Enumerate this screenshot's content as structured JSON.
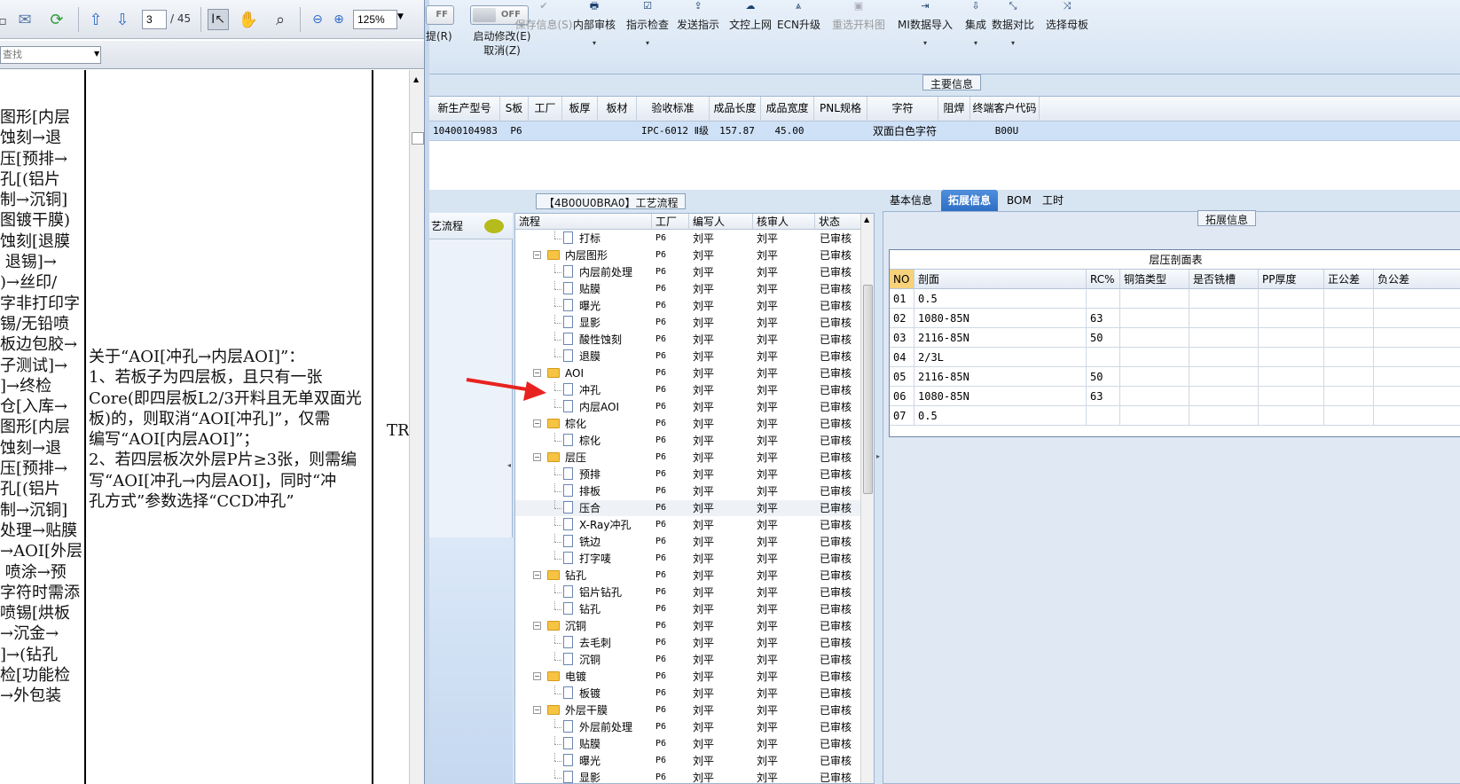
{
  "pdf": {
    "page_current": "3",
    "page_total": "/ 45",
    "zoom": "125%",
    "find_placeholder": "查找",
    "left_column_lines": [
      "图形[内层",
      "蚀刻→退",
      "压[预排→",
      "孔[(铝片",
      "制→沉铜]",
      "图镀干膜)",
      "蚀刻[退膜",
      " 退锡]→",
      ")→丝印/",
      "字非打印字",
      "锡/无铅喷",
      "板边包胶→",
      "子测试]→",
      "]→终检",
      "仓[入库→",
      "",
      "",
      "图形[内层",
      "蚀刻→退",
      "压[预排→",
      "孔[(铝片",
      "制→沉铜]",
      "处理→贴膜",
      "→AOI[外层",
      " 喷涂→预",
      "字符时需添",
      "喷锡[烘板",
      "→沉金→",
      "]→(钻孔",
      "检[功能检",
      "→外包装"
    ],
    "note_lines": [
      "关于“AOI[冲孔→内层AOI]”：",
      "1、若板子为四层板，且只有一张",
      "Core(即四层板L2/3开料且无单双面光",
      "板)的，则取消“AOI[冲孔]”，仅需",
      "编写“AOI[内层AOI]”；",
      "2、若四层板次外层P片≥3张，则需编",
      "写“AOI[冲孔→内层AOI]，同时“冲",
      "孔方式”参数选择“CCD冲孔”"
    ],
    "right_col_text": "TRU"
  },
  "ribbon": {
    "toggle1_text": "FF",
    "toggle1_label": "提(R)",
    "toggle2_text": "OFF",
    "toggle2_label1": "启动修改(E)",
    "toggle2_label2": "取消(Z)",
    "buttons": [
      {
        "label": "保存信息(S)",
        "icon": "✔",
        "disabled": true
      },
      {
        "label": "内部审核",
        "icon": "🖶",
        "disabled": false,
        "dropdown": "▾"
      },
      {
        "label": "指示检查",
        "icon": "☑",
        "disabled": false,
        "dropdown": "▾"
      },
      {
        "label": "发送指示",
        "icon": "⇪",
        "disabled": false
      },
      {
        "label": "文控上网",
        "icon": "☁",
        "disabled": false
      },
      {
        "label": "ECN升级",
        "icon": "⩓",
        "disabled": false
      },
      {
        "label": "重选开料图",
        "icon": "▣",
        "disabled": true
      },
      {
        "label": "MI数据导入",
        "icon": "⇥",
        "disabled": false,
        "dropdown": "▾"
      },
      {
        "label": "集成",
        "icon": "⇩",
        "disabled": false,
        "dropdown": "▾"
      },
      {
        "label": "数据对比",
        "icon": "⤡",
        "disabled": false,
        "dropdown": "▾"
      },
      {
        "label": "选择母板",
        "icon": "⤨",
        "disabled": false
      }
    ]
  },
  "main_info": {
    "title": "主要信息",
    "headers": [
      "新生产型号",
      "S板",
      "工厂",
      "板厚",
      "板材",
      "验收标准",
      "成品长度",
      "成品宽度",
      "PNL规格",
      "字符",
      "阻焊",
      "终端客户代码"
    ],
    "row": [
      "10400104983",
      "P6",
      "",
      "",
      "",
      "IPC-6012 Ⅱ级",
      "157.87",
      "45.00",
      "",
      "双面白色字符",
      "",
      "B00U"
    ]
  },
  "process": {
    "title": "【4B00U0BRA0】工艺流程",
    "side_label": "艺流程",
    "headers": [
      "流程",
      "工厂",
      "编写人",
      "核审人",
      "状态"
    ],
    "rows": [
      {
        "level": 2,
        "name": "打标",
        "factory": "P6",
        "writer": "刘平",
        "reviewer": "刘平",
        "status": "已审核"
      },
      {
        "level": 1,
        "name": "内层图形",
        "factory": "P6",
        "writer": "刘平",
        "reviewer": "刘平",
        "status": "已审核"
      },
      {
        "level": 2,
        "name": "内层前处理",
        "factory": "P6",
        "writer": "刘平",
        "reviewer": "刘平",
        "status": "已审核"
      },
      {
        "level": 2,
        "name": "贴膜",
        "factory": "P6",
        "writer": "刘平",
        "reviewer": "刘平",
        "status": "已审核"
      },
      {
        "level": 2,
        "name": "曝光",
        "factory": "P6",
        "writer": "刘平",
        "reviewer": "刘平",
        "status": "已审核"
      },
      {
        "level": 2,
        "name": "显影",
        "factory": "P6",
        "writer": "刘平",
        "reviewer": "刘平",
        "status": "已审核"
      },
      {
        "level": 2,
        "name": "酸性蚀刻",
        "factory": "P6",
        "writer": "刘平",
        "reviewer": "刘平",
        "status": "已审核"
      },
      {
        "level": 2,
        "name": "退膜",
        "factory": "P6",
        "writer": "刘平",
        "reviewer": "刘平",
        "status": "已审核"
      },
      {
        "level": 1,
        "name": "AOI",
        "factory": "P6",
        "writer": "刘平",
        "reviewer": "刘平",
        "status": "已审核"
      },
      {
        "level": 2,
        "name": "冲孔",
        "factory": "P6",
        "writer": "刘平",
        "reviewer": "刘平",
        "status": "已审核"
      },
      {
        "level": 2,
        "name": "内层AOI",
        "factory": "P6",
        "writer": "刘平",
        "reviewer": "刘平",
        "status": "已审核"
      },
      {
        "level": 1,
        "name": "棕化",
        "factory": "P6",
        "writer": "刘平",
        "reviewer": "刘平",
        "status": "已审核"
      },
      {
        "level": 2,
        "name": "棕化",
        "factory": "P6",
        "writer": "刘平",
        "reviewer": "刘平",
        "status": "已审核"
      },
      {
        "level": 1,
        "name": "层压",
        "factory": "P6",
        "writer": "刘平",
        "reviewer": "刘平",
        "status": "已审核"
      },
      {
        "level": 2,
        "name": "预排",
        "factory": "P6",
        "writer": "刘平",
        "reviewer": "刘平",
        "status": "已审核"
      },
      {
        "level": 2,
        "name": "排板",
        "factory": "P6",
        "writer": "刘平",
        "reviewer": "刘平",
        "status": "已审核"
      },
      {
        "level": 2,
        "name": "压合",
        "factory": "P6",
        "writer": "刘平",
        "reviewer": "刘平",
        "status": "已审核",
        "selected": true
      },
      {
        "level": 2,
        "name": "X-Ray冲孔",
        "factory": "P6",
        "writer": "刘平",
        "reviewer": "刘平",
        "status": "已审核"
      },
      {
        "level": 2,
        "name": "铣边",
        "factory": "P6",
        "writer": "刘平",
        "reviewer": "刘平",
        "status": "已审核"
      },
      {
        "level": 2,
        "name": "打字唛",
        "factory": "P6",
        "writer": "刘平",
        "reviewer": "刘平",
        "status": "已审核"
      },
      {
        "level": 1,
        "name": "钻孔",
        "factory": "P6",
        "writer": "刘平",
        "reviewer": "刘平",
        "status": "已审核"
      },
      {
        "level": 2,
        "name": "铝片钻孔",
        "factory": "P6",
        "writer": "刘平",
        "reviewer": "刘平",
        "status": "已审核"
      },
      {
        "level": 2,
        "name": "钻孔",
        "factory": "P6",
        "writer": "刘平",
        "reviewer": "刘平",
        "status": "已审核"
      },
      {
        "level": 1,
        "name": "沉铜",
        "factory": "P6",
        "writer": "刘平",
        "reviewer": "刘平",
        "status": "已审核"
      },
      {
        "level": 2,
        "name": "去毛刺",
        "factory": "P6",
        "writer": "刘平",
        "reviewer": "刘平",
        "status": "已审核"
      },
      {
        "level": 2,
        "name": "沉铜",
        "factory": "P6",
        "writer": "刘平",
        "reviewer": "刘平",
        "status": "已审核"
      },
      {
        "level": 1,
        "name": "电镀",
        "factory": "P6",
        "writer": "刘平",
        "reviewer": "刘平",
        "status": "已审核"
      },
      {
        "level": 2,
        "name": "板镀",
        "factory": "P6",
        "writer": "刘平",
        "reviewer": "刘平",
        "status": "已审核"
      },
      {
        "level": 1,
        "name": "外层干膜",
        "factory": "P6",
        "writer": "刘平",
        "reviewer": "刘平",
        "status": "已审核"
      },
      {
        "level": 2,
        "name": "外层前处理",
        "factory": "P6",
        "writer": "刘平",
        "reviewer": "刘平",
        "status": "已审核"
      },
      {
        "level": 2,
        "name": "贴膜",
        "factory": "P6",
        "writer": "刘平",
        "reviewer": "刘平",
        "status": "已审核"
      },
      {
        "level": 2,
        "name": "曝光",
        "factory": "P6",
        "writer": "刘平",
        "reviewer": "刘平",
        "status": "已审核"
      },
      {
        "level": 2,
        "name": "显影",
        "factory": "P6",
        "writer": "刘平",
        "reviewer": "刘平",
        "status": "已审核"
      }
    ]
  },
  "detail": {
    "tabs": [
      {
        "label": "基本信息",
        "active": false
      },
      {
        "label": "拓展信息",
        "active": true
      },
      {
        "label": "BOM",
        "active": false
      },
      {
        "label": "工时",
        "active": false
      }
    ],
    "section_title": "拓展信息",
    "table_title": "层压剖面表",
    "headers": [
      "NO",
      "剖面",
      "RC%",
      "铜箔类型",
      "是否铣槽",
      "PP厚度",
      "正公差",
      "负公差"
    ],
    "rows": [
      [
        "01",
        "0.5",
        "",
        "",
        "",
        "",
        "",
        ""
      ],
      [
        "02",
        "1080-85N",
        "63",
        "",
        "",
        "",
        "",
        ""
      ],
      [
        "03",
        "2116-85N",
        "50",
        "",
        "",
        "",
        "",
        ""
      ],
      [
        "04",
        "2/3L",
        "",
        "",
        "",
        "",
        "",
        ""
      ],
      [
        "05",
        "2116-85N",
        "50",
        "",
        "",
        "",
        "",
        ""
      ],
      [
        "06",
        "1080-85N",
        "63",
        "",
        "",
        "",
        "",
        ""
      ],
      [
        "07",
        "0.5",
        "",
        "",
        "",
        "",
        "",
        ""
      ]
    ]
  },
  "colors": {
    "accent": "#2e6ec4",
    "annotation_arrow": "#e8231f"
  }
}
